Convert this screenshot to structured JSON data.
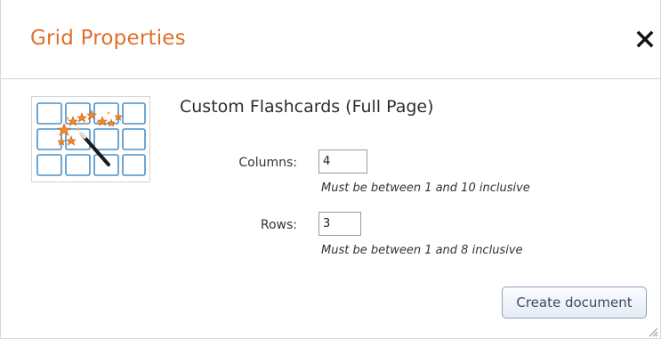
{
  "dialog": {
    "title": "Grid Properties",
    "close_icon": "close-icon"
  },
  "document": {
    "title": "Custom Flashcards (Full Page)",
    "thumbnail_icon": "grid-magic-wand-icon"
  },
  "fields": {
    "columns": {
      "label": "Columns:",
      "value": "4",
      "hint": "Must be between 1 and 10 inclusive"
    },
    "rows": {
      "label": "Rows:",
      "value": "3",
      "hint": "Must be between 1 and 8 inclusive"
    }
  },
  "actions": {
    "create_label": "Create document"
  },
  "colors": {
    "title_accent": "#e0702c",
    "grid_cell_border": "#4a90c8",
    "button_border": "#8ea0bc"
  }
}
